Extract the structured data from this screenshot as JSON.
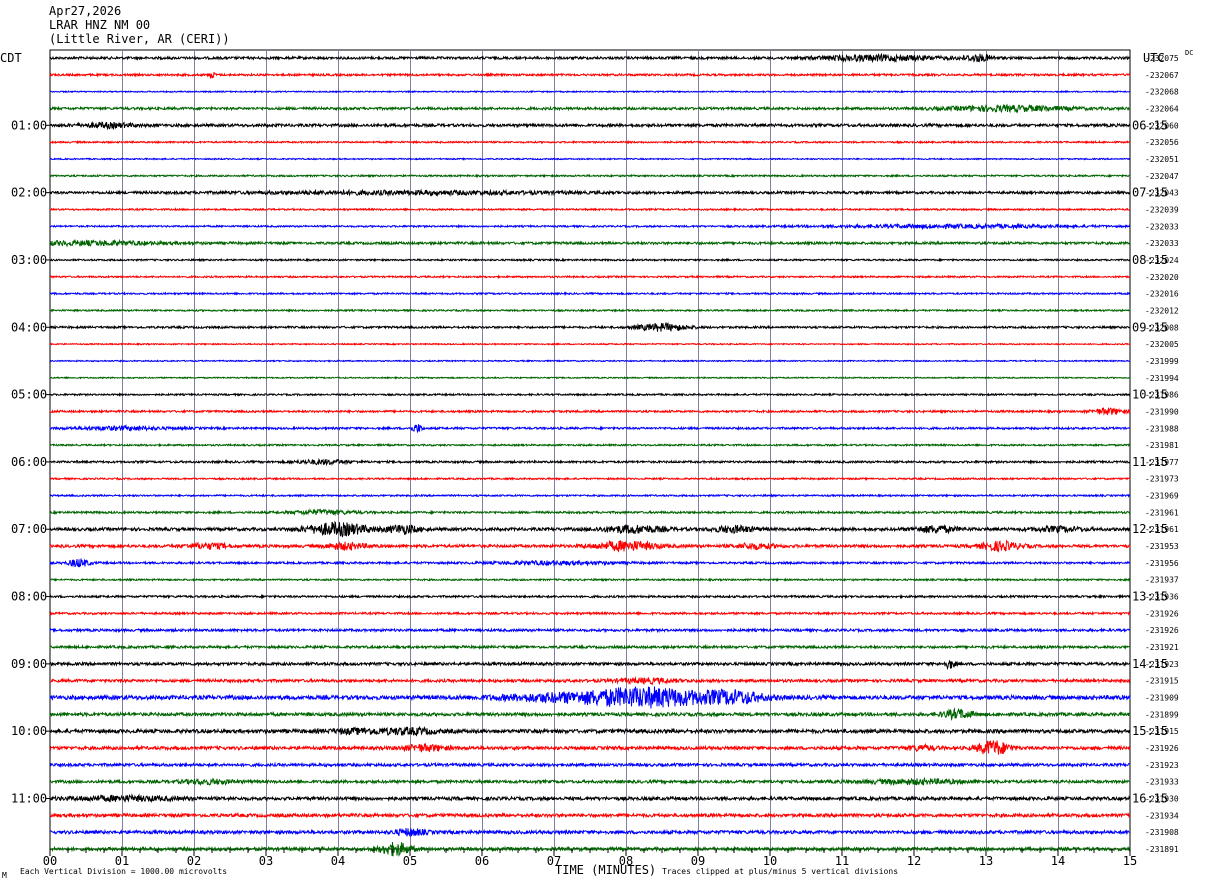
{
  "header": {
    "date": "Apr27,2026",
    "station": "LRAR HNZ NM 00",
    "location": "(Little River, AR (CERI))"
  },
  "left_timezone": "CDT",
  "right_timezone": "UTC",
  "dc_label": "DC",
  "footer": {
    "left_mark": "M",
    "scale_note": "Each Vertical Division = 1000.00 microvolts",
    "clip_note": "Traces clipped at plus/minus 5 vertical divisions"
  },
  "chart_data": {
    "type": "line",
    "title": "",
    "xlabel": "TIME (MINUTES)",
    "ylabel": "",
    "xlim": [
      0,
      15
    ],
    "x_ticks": [
      "00",
      "01",
      "02",
      "03",
      "04",
      "05",
      "06",
      "07",
      "08",
      "09",
      "10",
      "11",
      "12",
      "13",
      "14",
      "15"
    ],
    "left_time_labels": [
      "01:00",
      "02:00",
      "03:00",
      "04:00",
      "05:00",
      "06:00",
      "07:00",
      "08:00",
      "09:00",
      "10:00",
      "11:00"
    ],
    "right_time_labels": [
      "06:15",
      "07:15",
      "08:15",
      "09:15",
      "10:15",
      "11:15",
      "12:15",
      "13:15",
      "14:15",
      "15:15",
      "16:15"
    ],
    "trace_colors": [
      "#000000",
      "#ff0000",
      "#0000ff",
      "#006400"
    ],
    "dc_offsets": [
      "-232075",
      "-232067",
      "-232068",
      "-232064",
      "-232060",
      "-232056",
      "-232051",
      "-232047",
      "-232043",
      "-232039",
      "-232033",
      "-232033",
      "-232024",
      "-232020",
      "-232016",
      "-232012",
      "-232008",
      "-232005",
      "-231999",
      "-231994",
      "-231986",
      "-231990",
      "-231988",
      "-231981",
      "-231977",
      "-231973",
      "-231969",
      "-231961",
      "-231961",
      "-231953",
      "-231956",
      "-231937",
      "-231936",
      "-231926",
      "-231926",
      "-231921",
      "-231923",
      "-231915",
      "-231909",
      "-231899",
      "-231915",
      "-231926",
      "-231923",
      "-231933",
      "-231930",
      "-231934",
      "-231908",
      "-231891"
    ],
    "series": [
      {
        "noise": 1.2,
        "bursts": [
          {
            "t": 11.5,
            "w": 1.2,
            "a": 2.5
          },
          {
            "t": 12.9,
            "w": 0.3,
            "a": 3
          }
        ]
      },
      {
        "noise": 1.0,
        "bursts": [
          {
            "t": 2.25,
            "w": 0.05,
            "a": 4
          }
        ]
      },
      {
        "noise": 0.6,
        "bursts": []
      },
      {
        "noise": 1.2,
        "bursts": [
          {
            "t": 13.3,
            "w": 1.2,
            "a": 2.5
          }
        ]
      },
      {
        "noise": 1.4,
        "bursts": [
          {
            "t": 0.8,
            "w": 0.5,
            "a": 2
          }
        ]
      },
      {
        "noise": 0.8,
        "bursts": []
      },
      {
        "noise": 0.6,
        "bursts": []
      },
      {
        "noise": 0.8,
        "bursts": []
      },
      {
        "noise": 1.2,
        "bursts": [
          {
            "t": 5.0,
            "w": 3.0,
            "a": 1.5
          }
        ]
      },
      {
        "noise": 0.8,
        "bursts": []
      },
      {
        "noise": 0.8,
        "bursts": [
          {
            "t": 12.5,
            "w": 2.5,
            "a": 1.5
          }
        ]
      },
      {
        "noise": 1.2,
        "bursts": [
          {
            "t": 0.5,
            "w": 1.5,
            "a": 1.8
          }
        ]
      },
      {
        "noise": 0.8,
        "bursts": []
      },
      {
        "noise": 0.8,
        "bursts": []
      },
      {
        "noise": 0.8,
        "bursts": []
      },
      {
        "noise": 0.8,
        "bursts": []
      },
      {
        "noise": 1.0,
        "bursts": [
          {
            "t": 8.5,
            "w": 0.5,
            "a": 3.5
          }
        ]
      },
      {
        "noise": 0.6,
        "bursts": []
      },
      {
        "noise": 0.6,
        "bursts": []
      },
      {
        "noise": 0.6,
        "bursts": []
      },
      {
        "noise": 0.8,
        "bursts": []
      },
      {
        "noise": 1.0,
        "bursts": [
          {
            "t": 14.7,
            "w": 0.3,
            "a": 3
          }
        ]
      },
      {
        "noise": 1.0,
        "bursts": [
          {
            "t": 5.1,
            "w": 0.1,
            "a": 4
          },
          {
            "t": 1.0,
            "w": 1.0,
            "a": 1.5
          }
        ]
      },
      {
        "noise": 0.8,
        "bursts": []
      },
      {
        "noise": 1.0,
        "bursts": [
          {
            "t": 3.8,
            "w": 0.5,
            "a": 2
          }
        ]
      },
      {
        "noise": 0.8,
        "bursts": []
      },
      {
        "noise": 0.8,
        "bursts": []
      },
      {
        "noise": 1.0,
        "bursts": [
          {
            "t": 3.8,
            "w": 0.6,
            "a": 2
          }
        ]
      },
      {
        "noise": 1.5,
        "bursts": [
          {
            "t": 4.0,
            "w": 0.6,
            "a": 6
          },
          {
            "t": 4.9,
            "w": 0.3,
            "a": 4
          },
          {
            "t": 8.1,
            "w": 0.6,
            "a": 3.5
          },
          {
            "t": 9.5,
            "w": 0.4,
            "a": 3
          },
          {
            "t": 12.3,
            "w": 0.4,
            "a": 3
          },
          {
            "t": 14.0,
            "w": 0.5,
            "a": 2
          }
        ]
      },
      {
        "noise": 1.4,
        "bursts": [
          {
            "t": 2.2,
            "w": 0.4,
            "a": 2.5
          },
          {
            "t": 4.1,
            "w": 0.4,
            "a": 3
          },
          {
            "t": 8.0,
            "w": 0.6,
            "a": 4.5
          },
          {
            "t": 9.8,
            "w": 0.4,
            "a": 2.5
          },
          {
            "t": 13.2,
            "w": 0.4,
            "a": 4
          }
        ]
      },
      {
        "noise": 1.0,
        "bursts": [
          {
            "t": 0.4,
            "w": 0.2,
            "a": 4
          },
          {
            "t": 7.0,
            "w": 1.2,
            "a": 1.5
          }
        ]
      },
      {
        "noise": 0.8,
        "bursts": []
      },
      {
        "noise": 1.0,
        "bursts": []
      },
      {
        "noise": 1.0,
        "bursts": []
      },
      {
        "noise": 1.2,
        "bursts": []
      },
      {
        "noise": 1.2,
        "bursts": []
      },
      {
        "noise": 1.4,
        "bursts": [
          {
            "t": 12.5,
            "w": 0.1,
            "a": 4
          }
        ]
      },
      {
        "noise": 1.4,
        "bursts": [
          {
            "t": 8.3,
            "w": 0.6,
            "a": 2
          }
        ]
      },
      {
        "noise": 2.0,
        "bursts": [
          {
            "t": 8.3,
            "w": 1.2,
            "a": 9
          },
          {
            "t": 9.5,
            "w": 0.6,
            "a": 5
          },
          {
            "t": 7.0,
            "w": 1.2,
            "a": 3
          }
        ]
      },
      {
        "noise": 1.6,
        "bursts": [
          {
            "t": 12.6,
            "w": 0.3,
            "a": 4
          }
        ]
      },
      {
        "noise": 1.8,
        "bursts": [
          {
            "t": 5.0,
            "w": 0.5,
            "a": 2.5
          },
          {
            "t": 4.3,
            "w": 0.6,
            "a": 2
          }
        ]
      },
      {
        "noise": 1.6,
        "bursts": [
          {
            "t": 5.2,
            "w": 0.4,
            "a": 3
          },
          {
            "t": 13.1,
            "w": 0.3,
            "a": 7
          },
          {
            "t": 12.1,
            "w": 0.3,
            "a": 2
          }
        ]
      },
      {
        "noise": 1.4,
        "bursts": []
      },
      {
        "noise": 1.4,
        "bursts": [
          {
            "t": 2.2,
            "w": 0.5,
            "a": 2
          },
          {
            "t": 12.0,
            "w": 1.0,
            "a": 2
          }
        ]
      },
      {
        "noise": 1.6,
        "bursts": [
          {
            "t": 1.0,
            "w": 1.0,
            "a": 2
          }
        ]
      },
      {
        "noise": 1.6,
        "bursts": []
      },
      {
        "noise": 1.6,
        "bursts": [
          {
            "t": 5.0,
            "w": 0.3,
            "a": 3
          }
        ]
      },
      {
        "noise": 1.6,
        "bursts": [
          {
            "t": 4.8,
            "w": 0.3,
            "a": 6
          }
        ]
      }
    ]
  }
}
